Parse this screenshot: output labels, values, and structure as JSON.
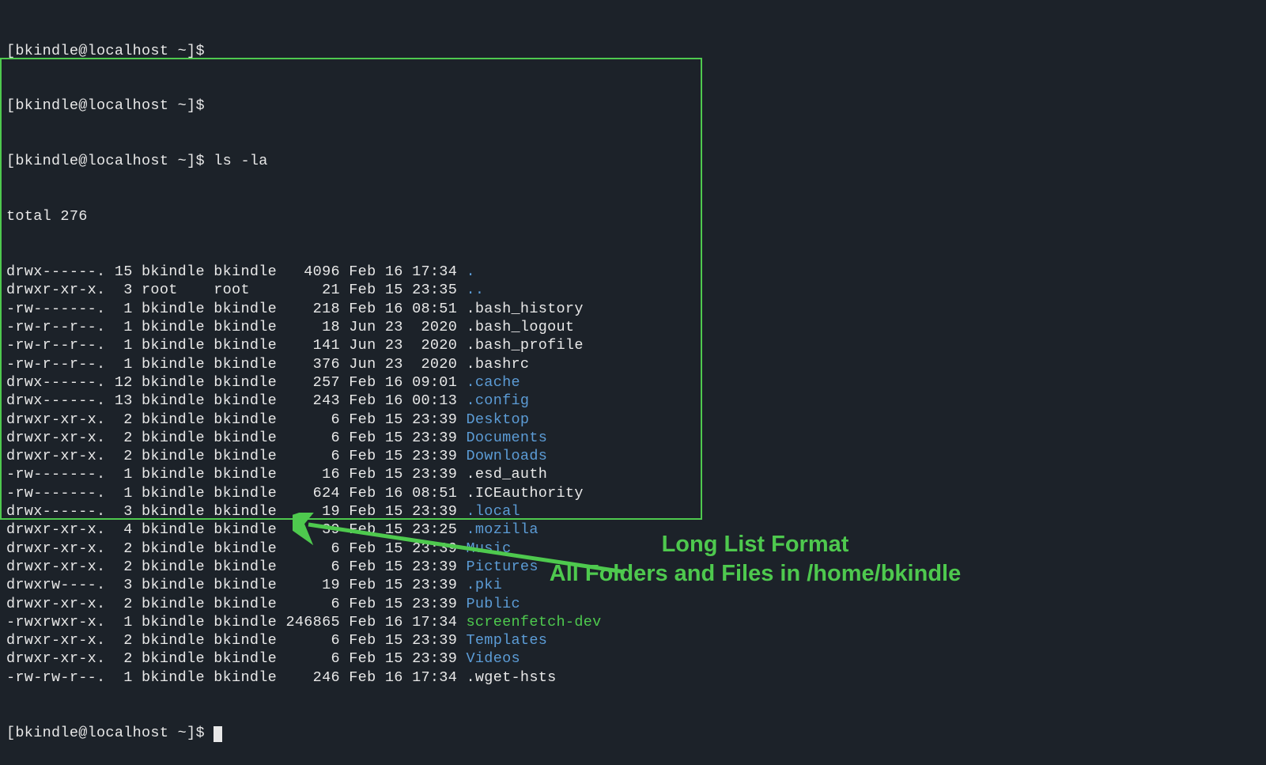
{
  "prompts": {
    "p1": "[bkindle@localhost ~]$ ",
    "p2": "[bkindle@localhost ~]$ ",
    "p3_prefix": "[bkindle@localhost ~]$ ",
    "p3_cmd": "ls -la",
    "p4": "[bkindle@localhost ~]$ "
  },
  "total": "total 276",
  "rows": [
    {
      "pre": "drwx------. 15 bkindle bkindle   4096 Feb 16 17:34 ",
      "name": ".",
      "cls": "dir"
    },
    {
      "pre": "drwxr-xr-x.  3 root    root        21 Feb 15 23:35 ",
      "name": "..",
      "cls": "dir"
    },
    {
      "pre": "-rw-------.  1 bkindle bkindle    218 Feb 16 08:51 ",
      "name": ".bash_history",
      "cls": "normal"
    },
    {
      "pre": "-rw-r--r--.  1 bkindle bkindle     18 Jun 23  2020 ",
      "name": ".bash_logout",
      "cls": "normal"
    },
    {
      "pre": "-rw-r--r--.  1 bkindle bkindle    141 Jun 23  2020 ",
      "name": ".bash_profile",
      "cls": "normal"
    },
    {
      "pre": "-rw-r--r--.  1 bkindle bkindle    376 Jun 23  2020 ",
      "name": ".bashrc",
      "cls": "normal"
    },
    {
      "pre": "drwx------. 12 bkindle bkindle    257 Feb 16 09:01 ",
      "name": ".cache",
      "cls": "dir"
    },
    {
      "pre": "drwx------. 13 bkindle bkindle    243 Feb 16 00:13 ",
      "name": ".config",
      "cls": "dir"
    },
    {
      "pre": "drwxr-xr-x.  2 bkindle bkindle      6 Feb 15 23:39 ",
      "name": "Desktop",
      "cls": "dir"
    },
    {
      "pre": "drwxr-xr-x.  2 bkindle bkindle      6 Feb 15 23:39 ",
      "name": "Documents",
      "cls": "dir"
    },
    {
      "pre": "drwxr-xr-x.  2 bkindle bkindle      6 Feb 15 23:39 ",
      "name": "Downloads",
      "cls": "dir"
    },
    {
      "pre": "-rw-------.  1 bkindle bkindle     16 Feb 15 23:39 ",
      "name": ".esd_auth",
      "cls": "normal"
    },
    {
      "pre": "-rw-------.  1 bkindle bkindle    624 Feb 16 08:51 ",
      "name": ".ICEauthority",
      "cls": "normal"
    },
    {
      "pre": "drwx------.  3 bkindle bkindle     19 Feb 15 23:39 ",
      "name": ".local",
      "cls": "dir"
    },
    {
      "pre": "drwxr-xr-x.  4 bkindle bkindle     39 Feb 15 23:25 ",
      "name": ".mozilla",
      "cls": "dir"
    },
    {
      "pre": "drwxr-xr-x.  2 bkindle bkindle      6 Feb 15 23:39 ",
      "name": "Music",
      "cls": "dir"
    },
    {
      "pre": "drwxr-xr-x.  2 bkindle bkindle      6 Feb 15 23:39 ",
      "name": "Pictures",
      "cls": "dir"
    },
    {
      "pre": "drwxrw----.  3 bkindle bkindle     19 Feb 15 23:39 ",
      "name": ".pki",
      "cls": "dir"
    },
    {
      "pre": "drwxr-xr-x.  2 bkindle bkindle      6 Feb 15 23:39 ",
      "name": "Public",
      "cls": "dir"
    },
    {
      "pre": "-rwxrwxr-x.  1 bkindle bkindle 246865 Feb 16 17:34 ",
      "name": "screenfetch-dev",
      "cls": "exec"
    },
    {
      "pre": "drwxr-xr-x.  2 bkindle bkindle      6 Feb 15 23:39 ",
      "name": "Templates",
      "cls": "dir"
    },
    {
      "pre": "drwxr-xr-x.  2 bkindle bkindle      6 Feb 15 23:39 ",
      "name": "Videos",
      "cls": "dir"
    },
    {
      "pre": "-rw-rw-r--.  1 bkindle bkindle    246 Feb 16 17:34 ",
      "name": ".wget-hsts",
      "cls": "normal"
    }
  ],
  "annotation": {
    "line1": "Long List Format",
    "line2": "All Folders and Files in /home/bkindle"
  }
}
